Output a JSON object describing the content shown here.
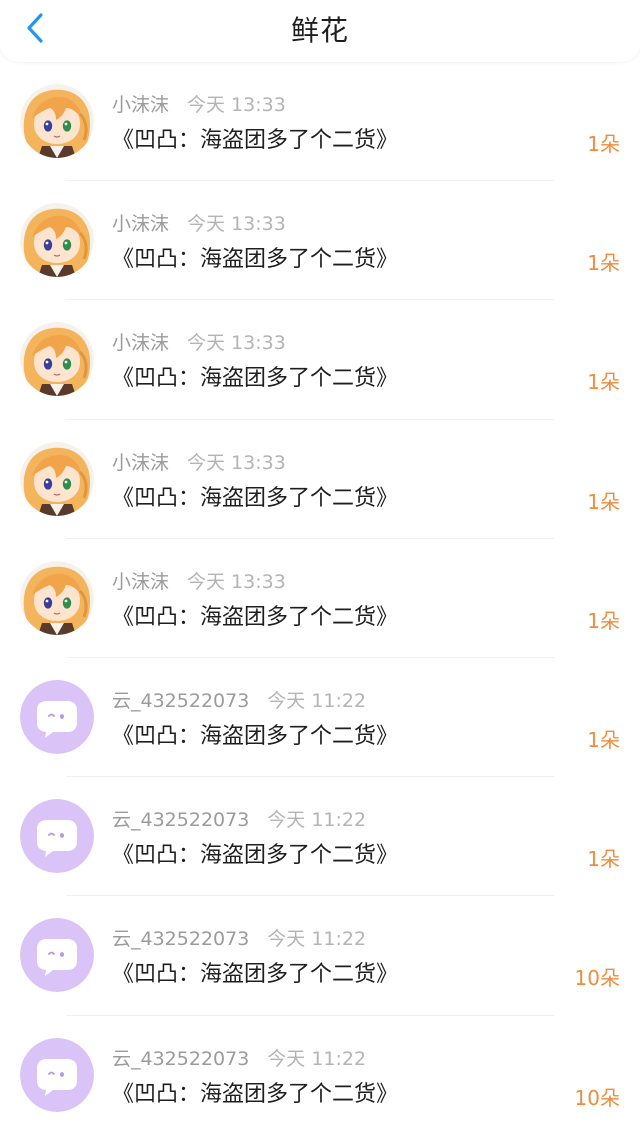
{
  "header": {
    "title": "鲜花",
    "back_icon": "chevron-left-icon",
    "accent": "#2196f3"
  },
  "colors": {
    "amount": "#f08c3c",
    "name": "#9b9b9b",
    "text": "#1f1f1f"
  },
  "items": [
    {
      "user": "小沫沫",
      "time": "今天 13:33",
      "book": "《凹凸：海盗团多了个二货》",
      "amount": "1朵",
      "avatar": "anime-girl-avatar"
    },
    {
      "user": "小沫沫",
      "time": "今天 13:33",
      "book": "《凹凸：海盗团多了个二货》",
      "amount": "1朵",
      "avatar": "anime-girl-avatar"
    },
    {
      "user": "小沫沫",
      "time": "今天 13:33",
      "book": "《凹凸：海盗团多了个二货》",
      "amount": "1朵",
      "avatar": "anime-girl-avatar"
    },
    {
      "user": "小沫沫",
      "time": "今天 13:33",
      "book": "《凹凸：海盗团多了个二货》",
      "amount": "1朵",
      "avatar": "anime-girl-avatar"
    },
    {
      "user": "小沫沫",
      "time": "今天 13:33",
      "book": "《凹凸：海盗团多了个二货》",
      "amount": "1朵",
      "avatar": "anime-girl-avatar"
    },
    {
      "user": "云_432522073",
      "time": "今天 11:22",
      "book": "《凹凸：海盗团多了个二货》",
      "amount": "1朵",
      "avatar": "default-chat-bubble-avatar"
    },
    {
      "user": "云_432522073",
      "time": "今天 11:22",
      "book": "《凹凸：海盗团多了个二货》",
      "amount": "1朵",
      "avatar": "default-chat-bubble-avatar"
    },
    {
      "user": "云_432522073",
      "time": "今天 11:22",
      "book": "《凹凸：海盗团多了个二货》",
      "amount": "10朵",
      "avatar": "default-chat-bubble-avatar"
    },
    {
      "user": "云_432522073",
      "time": "今天 11:22",
      "book": "《凹凸：海盗团多了个二货》",
      "amount": "10朵",
      "avatar": "default-chat-bubble-avatar"
    }
  ]
}
